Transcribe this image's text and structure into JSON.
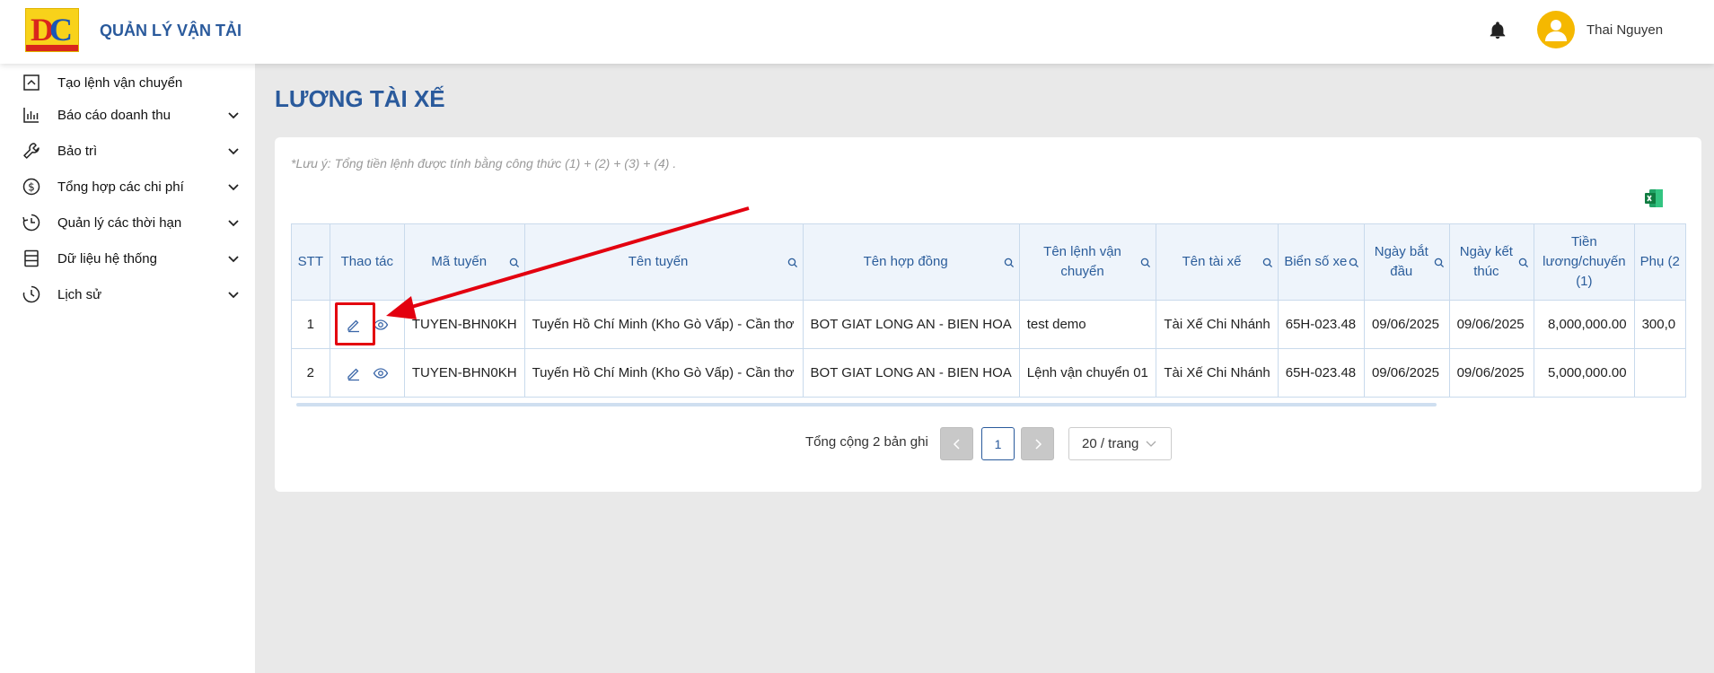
{
  "header": {
    "logo_text": "DC",
    "app_title": "QUẢN LÝ VẬN TẢI",
    "username": "Thai Nguyen"
  },
  "sidebar": {
    "items": [
      {
        "label": "Tạo lệnh vận chuyển",
        "icon": "transport-order-icon",
        "has_submenu": false
      },
      {
        "label": "Báo cáo doanh thu",
        "icon": "bar-chart-icon",
        "has_submenu": true
      },
      {
        "label": "Bảo trì",
        "icon": "wrench-icon",
        "has_submenu": true
      },
      {
        "label": "Tổng hợp các chi phí",
        "icon": "dollar-icon",
        "has_submenu": true
      },
      {
        "label": "Quản lý các thời hạn",
        "icon": "clock-icon",
        "has_submenu": true
      },
      {
        "label": "Dữ liệu hệ thống",
        "icon": "database-icon",
        "has_submenu": true
      },
      {
        "label": "Lịch sử",
        "icon": "history-icon",
        "has_submenu": true
      }
    ]
  },
  "main": {
    "page_title": "LƯƠNG TÀI XẾ",
    "note": "*Lưu ý: Tổng tiền lệnh được tính bằng công thức (1) + (2) + (3) + (4) .",
    "table": {
      "columns": [
        "STT",
        "Thao tác",
        "Mã tuyến",
        "Tên tuyến",
        "Tên hợp đồng",
        "Tên lệnh vận chuyển",
        "Tên tài xế",
        "Biển số xe",
        "Ngày bắt đầu",
        "Ngày kết thúc",
        "Tiền lương/chuyến (1)",
        "Phụ (2"
      ],
      "rows": [
        [
          "1",
          "",
          "TUYEN-BHN0KH",
          "Tuyến Hồ Chí Minh (Kho Gò Vấp) - Cần thơ",
          "BOT GIAT LONG AN - BIEN HOA",
          "test demo",
          "Tài Xế Chi Nhánh",
          "65H-023.48",
          "09/06/2025",
          "09/06/2025",
          "8,000,000.00",
          "300,0"
        ],
        [
          "2",
          "",
          "TUYEN-BHN0KH",
          "Tuyến Hồ Chí Minh (Kho Gò Vấp) - Cần thơ",
          "BOT GIAT LONG AN - BIEN HOA",
          "Lệnh vận chuyển 01",
          "Tài Xế Chi Nhánh",
          "65H-023.48",
          "09/06/2025",
          "09/06/2025",
          "5,000,000.00",
          ""
        ]
      ]
    },
    "pagination": {
      "total_text": "Tổng cộng 2 bản ghi",
      "current_page": "1",
      "page_size": "20 / trang"
    }
  },
  "colors": {
    "brand": "#2a5a9c",
    "header_bg": "#eef4fb",
    "annotation": "#e3000f",
    "avatar": "#f5b800"
  }
}
